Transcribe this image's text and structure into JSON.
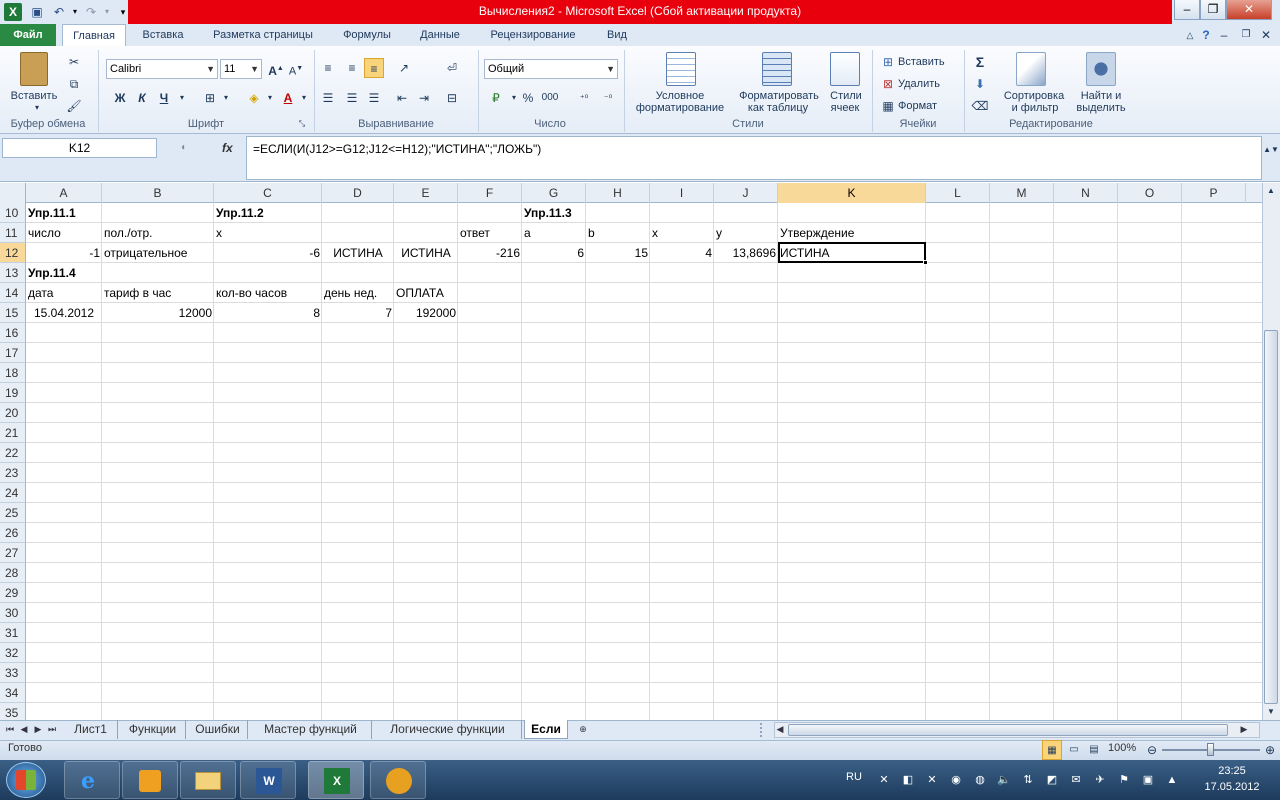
{
  "window": {
    "title": "Вычисления2 - Microsoft Excel (Сбой активации продукта)",
    "accent": "#e8000d"
  },
  "tabs": [
    "Файл",
    "Главная",
    "Вставка",
    "Разметка страницы",
    "Формулы",
    "Данные",
    "Рецензирование",
    "Вид"
  ],
  "ribbon": {
    "paste": "Вставить",
    "clipboard_group": "Буфер обмена",
    "font_name": "Calibri",
    "font_size": "11",
    "font_group": "Шрифт",
    "bold": "Ж",
    "italic": "К",
    "underline": "Ч",
    "align_group": "Выравнивание",
    "number_format": "Общий",
    "number_group": "Число",
    "percent": "%",
    "thousands": "000",
    "cond_format_1": "Условное",
    "cond_format_2": "форматирование",
    "format_table_1": "Форматировать",
    "format_table_2": "как таблицу",
    "cell_styles_1": "Стили",
    "cell_styles_2": "ячеек",
    "styles_group": "Стили",
    "insert": "Вставить",
    "delete": "Удалить",
    "format": "Формат",
    "cells_group": "Ячейки",
    "sigma": "Σ",
    "sort_1": "Сортировка",
    "sort_2": "и фильтр",
    "find_1": "Найти и",
    "find_2": "выделить",
    "editing_group": "Редактирование"
  },
  "formula_bar": {
    "name_box": "K12",
    "fx": "fx",
    "formula": "=ЕСЛИ(И(J12>=G12;J12<=H12);\"ИСТИНА\";\"ЛОЖЬ\")"
  },
  "columns": [
    "A",
    "B",
    "C",
    "D",
    "E",
    "F",
    "G",
    "H",
    "I",
    "J",
    "K",
    "L",
    "M",
    "N",
    "O",
    "P"
  ],
  "rows": [
    "10",
    "11",
    "12",
    "13",
    "14",
    "15",
    "16",
    "17",
    "18",
    "19",
    "20",
    "21",
    "22",
    "23",
    "24",
    "25",
    "26",
    "27",
    "28",
    "29",
    "30",
    "31",
    "32",
    "33",
    "34",
    "35"
  ],
  "cells": {
    "r10": {
      "a": "Упр.11.1",
      "c": "Упр.11.2",
      "g": "Упр.11.3"
    },
    "r11": {
      "a": "число",
      "b": "пол./отр.",
      "c": "x",
      "f": "ответ",
      "g": "a",
      "h": "b",
      "i": "x",
      "j": "y",
      "k": "Утверждение"
    },
    "r12": {
      "a": "-1",
      "b": "отрицательное",
      "c": "-6",
      "d": "ИСТИНА",
      "e": "ИСТИНА",
      "f": "-216",
      "g": "6",
      "h": "15",
      "i": "4",
      "j": "13,8696",
      "k": "ИСТИНА"
    },
    "r13": {
      "a": "Упр.11.4"
    },
    "r14": {
      "a": "дата",
      "b": "тариф в час",
      "c": "кол-во часов",
      "d": "день нед.",
      "e": "ОПЛАТА"
    },
    "r15": {
      "a": "15.04.2012",
      "b": "12000",
      "c": "8",
      "d": "7",
      "e": "192000"
    }
  },
  "sheets": [
    "Лист1",
    "Функции",
    "Ошибки",
    "Мастер функций",
    "Логические функции",
    "Если"
  ],
  "status": {
    "ready": "Готово",
    "zoom": "100%"
  },
  "taskbar": {
    "lang": "RU",
    "time": "23:25",
    "date": "17.05.2012"
  }
}
